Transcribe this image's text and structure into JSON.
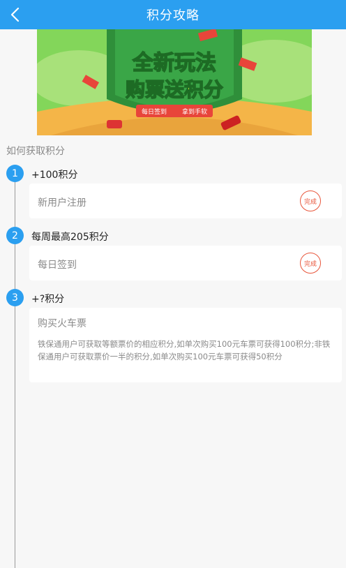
{
  "header": {
    "title": "积分攻略",
    "back_icon": "chevron-left-icon"
  },
  "banner": {
    "headline": "全新玩法",
    "subheadline": "购票送积分",
    "tag_left": "每日签到",
    "tag_right": "拿到手软",
    "colors": {
      "sky": "#7ed957",
      "shield": "#2f8f3a",
      "ground": "#f4b548",
      "ribbon": "#e8453a"
    }
  },
  "section_label": "如何获取积分",
  "steps": [
    {
      "number": "1",
      "title": "+100积分",
      "card_title": "新用户注册",
      "status": "完成"
    },
    {
      "number": "2",
      "title": "每周最高205积分",
      "card_title": "每日签到",
      "status": "完成"
    },
    {
      "number": "3",
      "title": "+?积分",
      "card_title": "购买火车票",
      "description": "铁保通用户可获取等额票价的相应积分,如单次购买100元车票可获得100积分;非铁保通用户可获取票价一半的积分,如单次购买100元车票可获得50积分"
    }
  ],
  "colors": {
    "accent": "#2b9ff0",
    "done": "#e8553a"
  }
}
